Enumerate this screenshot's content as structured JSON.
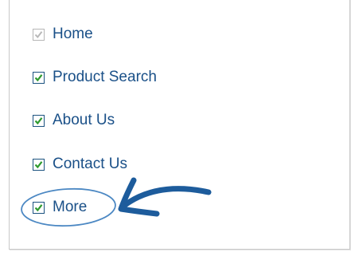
{
  "menu": {
    "items": [
      {
        "label": "Home",
        "checked": true,
        "disabled": true,
        "icon": "checkbox-checked-disabled-icon"
      },
      {
        "label": "Product Search",
        "checked": true,
        "disabled": false,
        "icon": "checkbox-checked-icon"
      },
      {
        "label": "About Us",
        "checked": true,
        "disabled": false,
        "icon": "checkbox-checked-icon"
      },
      {
        "label": "Contact Us",
        "checked": true,
        "disabled": false,
        "icon": "checkbox-checked-icon"
      },
      {
        "label": "More",
        "checked": true,
        "disabled": false,
        "icon": "checkbox-checked-icon"
      }
    ]
  },
  "annotation": {
    "type": "hand-drawn circle with arrow pointing to More",
    "color": "#1d5c9c"
  },
  "colors": {
    "label": "#1a5088",
    "checkbox_border": "#1c5380",
    "checkmark": "#2e9a2e",
    "checkmark_disabled": "#b8b8b8",
    "panel_border": "#c8c8c8"
  }
}
